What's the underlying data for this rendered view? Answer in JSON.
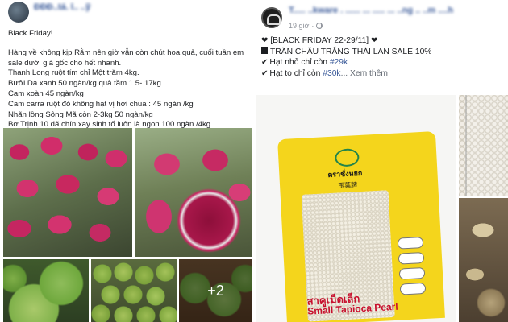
{
  "left_post": {
    "author": "ĐĐĐ..tá. l.. ..ỹ",
    "lines": [
      "Black Friday!",
      "Hàng về không kịp Rằm nên giờ vẫn còn chút hoa quả, cuối tuần em sale dưới giá gốc cho hết nhanh.",
      "Thanh Long ruột tím chỉ Một trăm 4kg.",
      "Bưởi Da xanh 50 ngàn/kg quả tầm 1.5-.17kg",
      "Cam xoàn 45 ngàn/kg",
      "Cam carra ruột đỏ không hạt vị hơi chua : 45 ngàn /kg",
      "Nhãn lồng Sông Mã còn 2-3kg 50 ngàn/kg",
      "Bơ Trịnh 10 đã chín xay sinh tố luôn là ngon 100 ngàn /4kg"
    ],
    "more_photos_label": "+2"
  },
  "right_post": {
    "author": "T..... ..kware . ...... ... ..... ... ..ng .. ..m ....h",
    "time": "19 giờ",
    "headline": "[BLACK FRIDAY 22-29/11]",
    "product": "TRÂN CHÂU TRẮNG THÁI LAN SALE 10%",
    "line_small": "Hạt nhỏ chỉ còn",
    "price_small": "#29k",
    "line_large": "Hạt to chỉ còn",
    "price_large": "#30k",
    "see_more": "... Xem thêm",
    "bag": {
      "brand": "ตราชั่งหยก",
      "cn": "玉葉牌",
      "thai": "สาคูเม็ดเล็ก",
      "en": "Small Tapioca Pearl"
    }
  },
  "colors": {
    "link": "#385898",
    "text": "#1c1e21",
    "meta": "#90949c",
    "bag_yellow": "#f4d51c"
  }
}
